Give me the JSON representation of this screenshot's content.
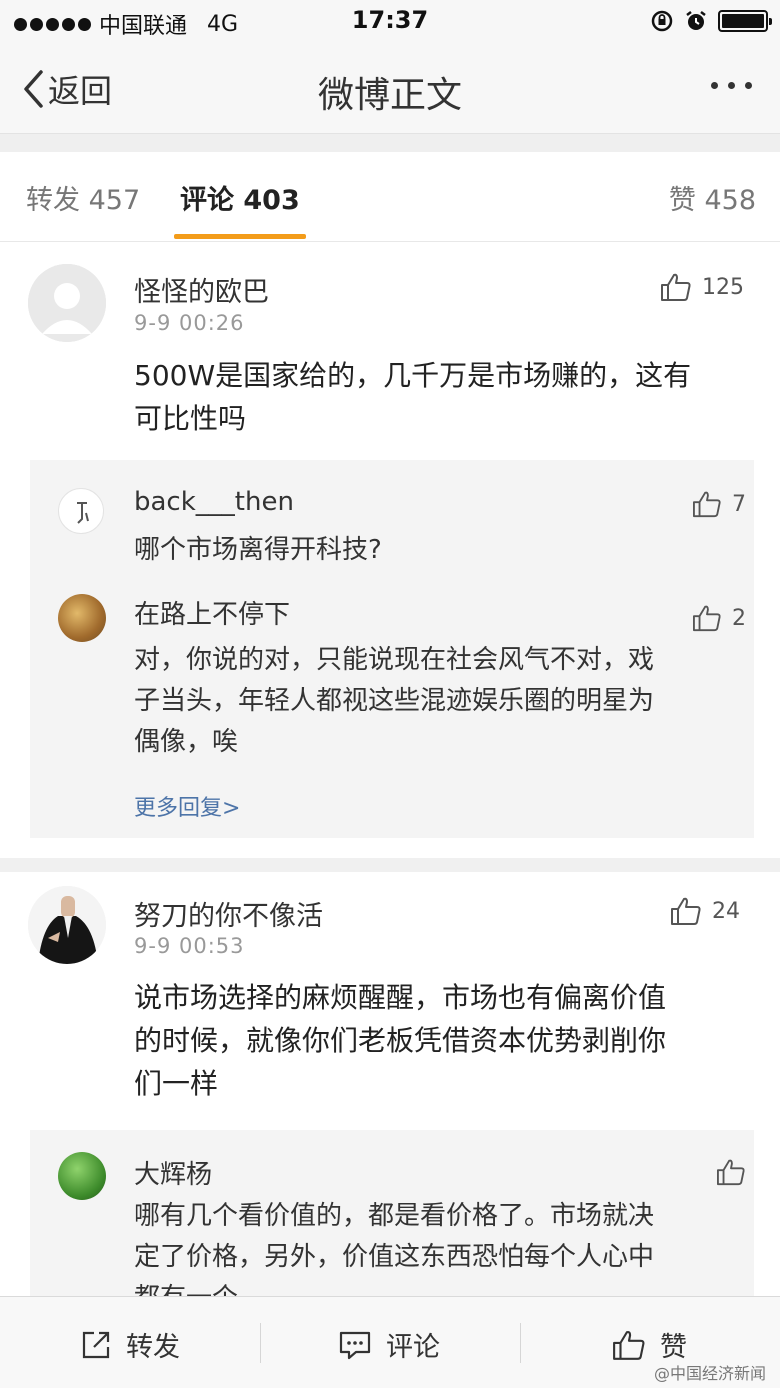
{
  "status_bar": {
    "carrier": "中国联通",
    "network": "4G",
    "time": "17:37"
  },
  "nav": {
    "back_label": "返回",
    "title": "微博正文"
  },
  "tabs": {
    "repost": "转发 457",
    "comment": "评论 403",
    "like": "赞 458"
  },
  "comments": [
    {
      "username": "怪怪的欧巴",
      "time": "9-9 00:26",
      "likes": "125",
      "text_lines": [
        "500W是国家给的，几千万是市场赚的，这有",
        "可比性吗"
      ],
      "replies": [
        {
          "username": "back___then",
          "likes": "7",
          "text_lines": [
            "哪个市场离得开科技?"
          ]
        },
        {
          "username": "在路上不停下",
          "likes": "2",
          "text_lines": [
            "对，你说的对，只能说现在社会风气不对，戏",
            "子当头，年轻人都视这些混迹娱乐圈的明星为",
            "偶像，唉"
          ]
        }
      ],
      "more_replies": "更多回复>"
    },
    {
      "username": "努刀的你不像活",
      "time": "9-9 00:53",
      "likes": "24",
      "text_lines": [
        "说市场选择的麻烦醒醒，市场也有偏离价值",
        "的时候，就像你们老板凭借资本优势剥削你",
        "们一样"
      ],
      "replies": [
        {
          "username": "大辉杨",
          "likes": "",
          "text_lines": [
            "哪有几个看价值的，都是看价格了。市场就决",
            "定了价格，另外，价值这东西恐怕每个人心中",
            "都有一个"
          ]
        }
      ]
    }
  ],
  "toolbar": {
    "repost": "转发",
    "comment": "评论",
    "like": "赞"
  },
  "watermark": "@中国经济新闻"
}
